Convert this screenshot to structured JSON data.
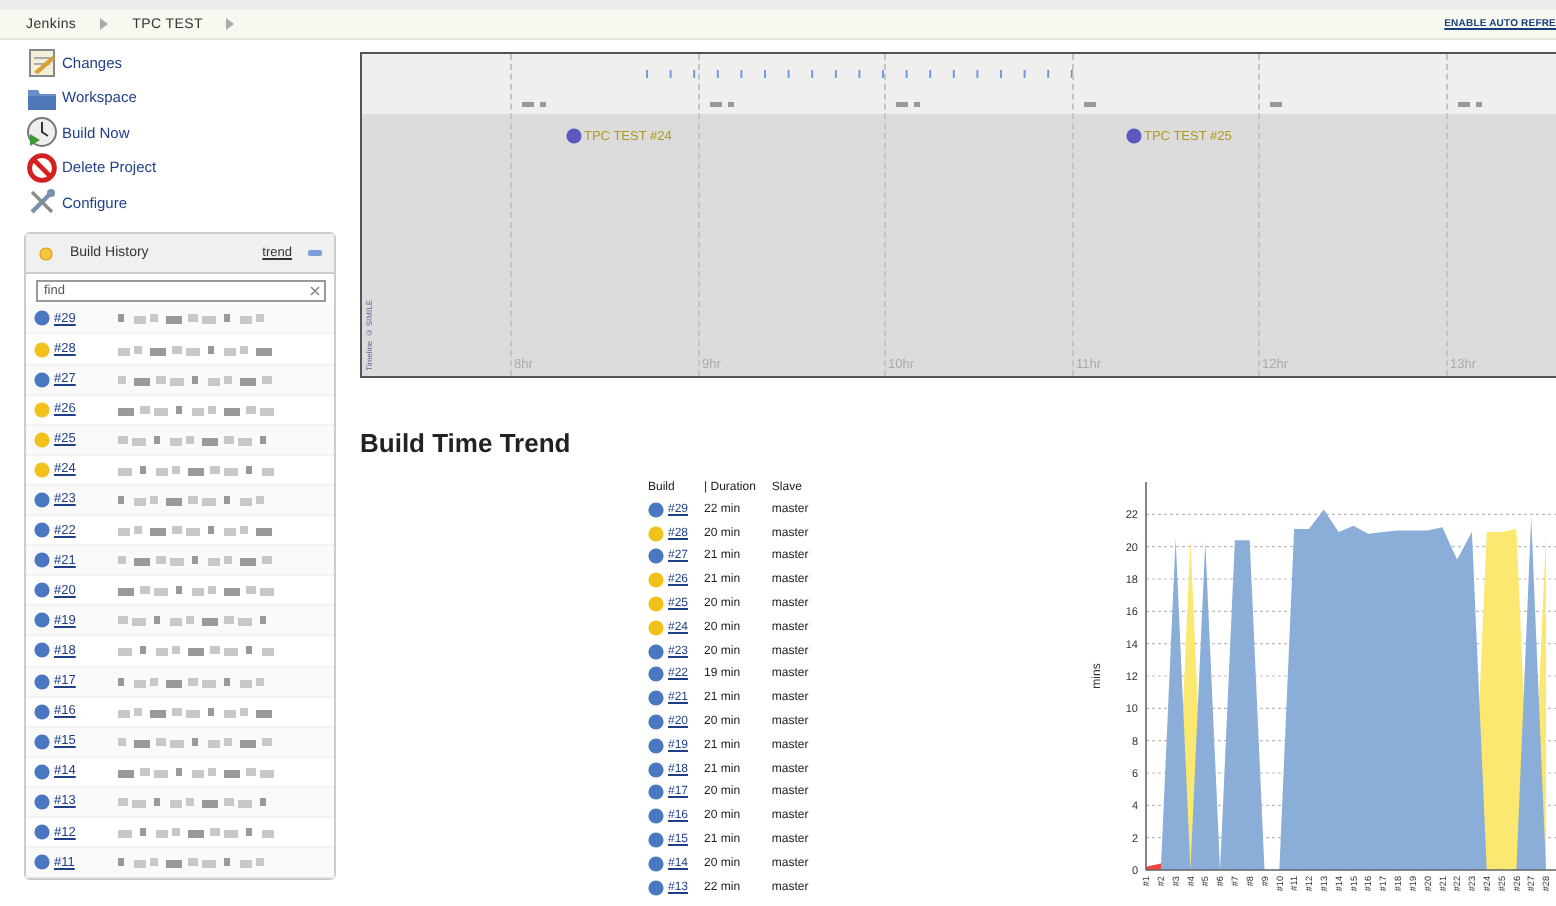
{
  "breadcrumb": {
    "items": [
      "Jenkins",
      "TPC TEST"
    ],
    "auto_refresh": "ENABLE AUTO REFRE"
  },
  "sidebar": {
    "tasks": [
      {
        "label": "Changes",
        "kind": "notepad"
      },
      {
        "label": "Workspace",
        "kind": "folder"
      },
      {
        "label": "Build Now",
        "kind": "clock"
      },
      {
        "label": "Delete Project",
        "kind": "prohibited"
      },
      {
        "label": "Configure",
        "kind": "tools"
      }
    ],
    "build_history": {
      "title": "Build History",
      "trend_link": "trend",
      "search": {
        "placeholder": "find"
      },
      "builds": [
        {
          "number": "#29",
          "color": "#4a78c0"
        },
        {
          "number": "#28",
          "color": "#f2c21a"
        },
        {
          "number": "#27",
          "color": "#4a78c0"
        },
        {
          "number": "#26",
          "color": "#f2c21a"
        },
        {
          "number": "#25",
          "color": "#f2c21a"
        },
        {
          "number": "#24",
          "color": "#f2c21a"
        },
        {
          "number": "#23",
          "color": "#4a78c0"
        },
        {
          "number": "#22",
          "color": "#4a78c0"
        },
        {
          "number": "#21",
          "color": "#4a78c0"
        },
        {
          "number": "#20",
          "color": "#4a78c0"
        },
        {
          "number": "#19",
          "color": "#4a78c0"
        },
        {
          "number": "#18",
          "color": "#4a78c0"
        },
        {
          "number": "#17",
          "color": "#4a78c0"
        },
        {
          "number": "#16",
          "color": "#4a78c0"
        },
        {
          "number": "#15",
          "color": "#4a78c0"
        },
        {
          "number": "#14",
          "color": "#4a78c0"
        },
        {
          "number": "#13",
          "color": "#4a78c0"
        },
        {
          "number": "#12",
          "color": "#4a78c0"
        },
        {
          "number": "#11",
          "color": "#4a78c0"
        }
      ]
    }
  },
  "timeline": {
    "events": [
      {
        "label": "TPC TEST #24"
      },
      {
        "label": "TPC TEST #25"
      }
    ],
    "hours": [
      "8hr",
      "9hr",
      "10hr",
      "11hr",
      "12hr",
      "13hr"
    ],
    "credit": "Timeline © SIMILE"
  },
  "trend": {
    "title": "Build Time Trend",
    "table": {
      "columns": [
        "Build",
        "| Duration",
        "Slave"
      ],
      "rows": [
        {
          "build": "#29",
          "color": "#4a78c0",
          "duration": "22 min",
          "slave": "master"
        },
        {
          "build": "#28",
          "color": "#f2c21a",
          "duration": "20 min",
          "slave": "master"
        },
        {
          "build": "#27",
          "color": "#4a78c0",
          "duration": "21 min",
          "slave": "master"
        },
        {
          "build": "#26",
          "color": "#f2c21a",
          "duration": "21 min",
          "slave": "master"
        },
        {
          "build": "#25",
          "color": "#f2c21a",
          "duration": "20 min",
          "slave": "master"
        },
        {
          "build": "#24",
          "color": "#f2c21a",
          "duration": "20 min",
          "slave": "master"
        },
        {
          "build": "#23",
          "color": "#4a78c0",
          "duration": "20 min",
          "slave": "master"
        },
        {
          "build": "#22",
          "color": "#4a78c0",
          "duration": "19 min",
          "slave": "master"
        },
        {
          "build": "#21",
          "color": "#4a78c0",
          "duration": "21 min",
          "slave": "master"
        },
        {
          "build": "#20",
          "color": "#4a78c0",
          "duration": "20 min",
          "slave": "master"
        },
        {
          "build": "#19",
          "color": "#4a78c0",
          "duration": "21 min",
          "slave": "master"
        },
        {
          "build": "#18",
          "color": "#4a78c0",
          "duration": "21 min",
          "slave": "master"
        },
        {
          "build": "#17",
          "color": "#4a78c0",
          "duration": "20 min",
          "slave": "master"
        },
        {
          "build": "#16",
          "color": "#4a78c0",
          "duration": "20 min",
          "slave": "master"
        },
        {
          "build": "#15",
          "color": "#4a78c0",
          "duration": "21 min",
          "slave": "master"
        },
        {
          "build": "#14",
          "color": "#4a78c0",
          "duration": "20 min",
          "slave": "master"
        },
        {
          "build": "#13",
          "color": "#4a78c0",
          "duration": "22 min",
          "slave": "master"
        }
      ]
    },
    "chart_data": {
      "type": "area",
      "ylabel": "mins",
      "stacked": false,
      "grid": true,
      "categories": [
        "#1",
        "#2",
        "#3",
        "#4",
        "#5",
        "#6",
        "#7",
        "#8",
        "#9",
        "#10",
        "#11",
        "#12",
        "#13",
        "#14",
        "#15",
        "#16",
        "#17",
        "#18",
        "#19",
        "#20",
        "#21",
        "#22",
        "#23",
        "#24",
        "#25",
        "#26",
        "#27",
        "#28"
      ],
      "series": [
        {
          "color": "#ee4444",
          "values": [
            0.2,
            0.4,
            0,
            0,
            0,
            0,
            0,
            0,
            0,
            0,
            0,
            0,
            0,
            0,
            0,
            0,
            0,
            0,
            0,
            0,
            0,
            0,
            0,
            0,
            0,
            0,
            0,
            0
          ]
        },
        {
          "color": "#fbe870",
          "values": [
            0,
            0,
            0,
            20.4,
            0,
            0,
            0,
            0,
            0,
            0,
            0,
            0,
            0,
            0,
            0,
            0,
            0,
            0,
            0,
            0,
            0,
            0,
            0,
            20.9,
            20.9,
            21.1,
            0,
            20.8
          ]
        },
        {
          "color": "#8aaed8",
          "values": [
            0,
            0,
            20.5,
            0,
            20.3,
            0,
            20.4,
            20.4,
            0,
            0,
            21.1,
            21.1,
            22.3,
            20.9,
            21.3,
            20.8,
            20.9,
            21.0,
            21.0,
            21.0,
            21.2,
            19.2,
            20.9,
            0,
            0,
            0,
            21.8,
            0
          ]
        }
      ],
      "ylim": [
        0,
        24
      ],
      "yticks": [
        0,
        2,
        4,
        6,
        8,
        10,
        12,
        14,
        16,
        18,
        20,
        22
      ]
    }
  }
}
